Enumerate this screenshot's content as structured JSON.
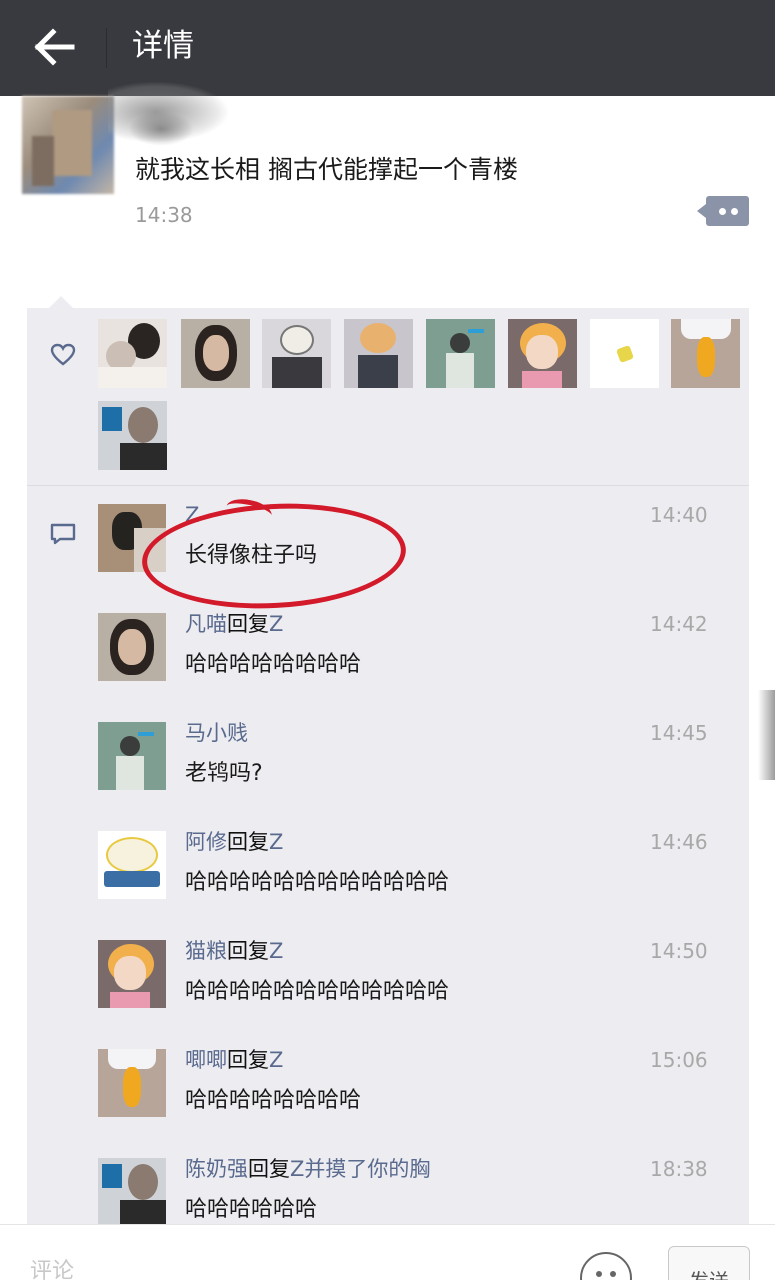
{
  "header": {
    "title": "详情",
    "back_icon": "arrow-left-icon"
  },
  "post": {
    "text": "就我这长相 搁古代能撑起一个青楼",
    "time": "14:38",
    "more_icon": "more-dots-icon"
  },
  "likes": {
    "icon": "heart-icon",
    "avatars": [
      "avatar-1",
      "avatar-2",
      "avatar-3",
      "avatar-4",
      "avatar-5",
      "avatar-6",
      "avatar-7",
      "avatar-8",
      "avatar-9"
    ]
  },
  "comments": {
    "icon": "comment-bubble-icon",
    "items": [
      {
        "name": "Z",
        "reply_word": "",
        "target": "",
        "time": "14:40",
        "text": "长得像柱子吗"
      },
      {
        "name": "凡喵",
        "reply_word": "回复",
        "target": "Z",
        "time": "14:42",
        "text": "哈哈哈哈哈哈哈哈"
      },
      {
        "name": "马小贱",
        "reply_word": "",
        "target": "",
        "time": "14:45",
        "text": "老鸨吗?"
      },
      {
        "name": "阿修",
        "reply_word": "回复",
        "target": "Z",
        "time": "14:46",
        "text": "哈哈哈哈哈哈哈哈哈哈哈哈"
      },
      {
        "name": "猫粮",
        "reply_word": "回复",
        "target": "Z",
        "time": "14:50",
        "text": "哈哈哈哈哈哈哈哈哈哈哈哈"
      },
      {
        "name": "唧唧",
        "reply_word": "回复",
        "target": "Z",
        "time": "15:06",
        "text": "哈哈哈哈哈哈哈哈"
      },
      {
        "name": "陈奶强",
        "reply_word": "回复",
        "target": "Z并摸了你的胸",
        "time": "18:38",
        "text": "哈哈哈哈哈哈"
      }
    ]
  },
  "annotation": {
    "color": "#d21a2a"
  },
  "footer": {
    "input_placeholder": "评论",
    "emoji_icon": "smiley-face-icon",
    "send_label": "发送"
  },
  "colors": {
    "topbar": "#393a3f",
    "panel": "#ededf1",
    "name_link": "#5a6a8e"
  }
}
